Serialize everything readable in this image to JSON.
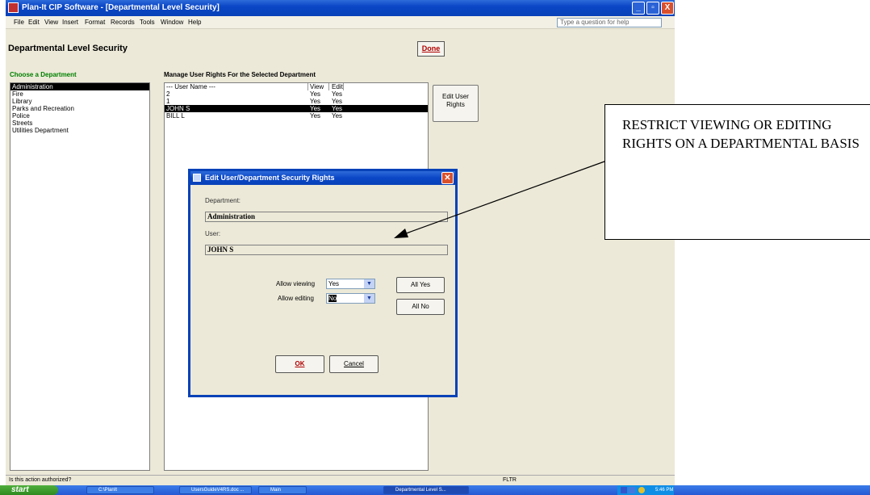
{
  "window": {
    "title": "Plan-It CIP Software - [Departmental Level Security]",
    "controls": [
      "_",
      "▫",
      "X"
    ]
  },
  "menu": [
    "File",
    "Edit",
    "View",
    "Insert",
    "Format",
    "Records",
    "Tools",
    "Window",
    "Help"
  ],
  "help_box": "Type a question for help",
  "form": {
    "title": "Departmental Level Security",
    "done_label": "Done",
    "choose_label": "Choose a Department",
    "departments": [
      "Administration",
      "Fire",
      "Library",
      "Parks and Recreation",
      "Police",
      "Streets",
      "Utilities Department"
    ],
    "selected_department_index": 0,
    "manage_label": "Manage User Rights For the Selected Department",
    "user_columns": [
      "--- User Name ---",
      "View",
      "Edit"
    ],
    "users": [
      {
        "name": "2",
        "view": "Yes",
        "edit": "Yes"
      },
      {
        "name": "1",
        "view": "Yes",
        "edit": "Yes"
      },
      {
        "name": "JOHN S",
        "view": "Yes",
        "edit": "Yes"
      },
      {
        "name": "BILL L",
        "view": "Yes",
        "edit": "Yes"
      }
    ],
    "selected_user_index": 2,
    "edit_rights_label": "Edit User Rights"
  },
  "dialog": {
    "title": "Edit User/Department Security Rights",
    "department_label": "Department:",
    "department_value": "Administration",
    "user_label": "User:",
    "user_value": "JOHN S",
    "allow_viewing_label": "Allow viewing",
    "allow_viewing_value": "Yes",
    "allow_editing_label": "Allow editing",
    "allow_editing_value": "No",
    "all_yes_label": "All Yes",
    "all_no_label": "All No",
    "ok_label": "OK",
    "cancel_label": "Cancel"
  },
  "status": {
    "message": "Is this action authorized?",
    "mode": "FLTR"
  },
  "taskbar": {
    "start_label": "start",
    "tasks": [
      "C:\\PlanIt",
      "UsersGuideV4RS.doc ...",
      "Main",
      "Departmental Level S..."
    ],
    "clock": "5:46 PM"
  },
  "callout": {
    "text": "RESTRICT VIEWING OR EDITING RIGHTS ON A DEPARTMENTAL BASIS"
  }
}
